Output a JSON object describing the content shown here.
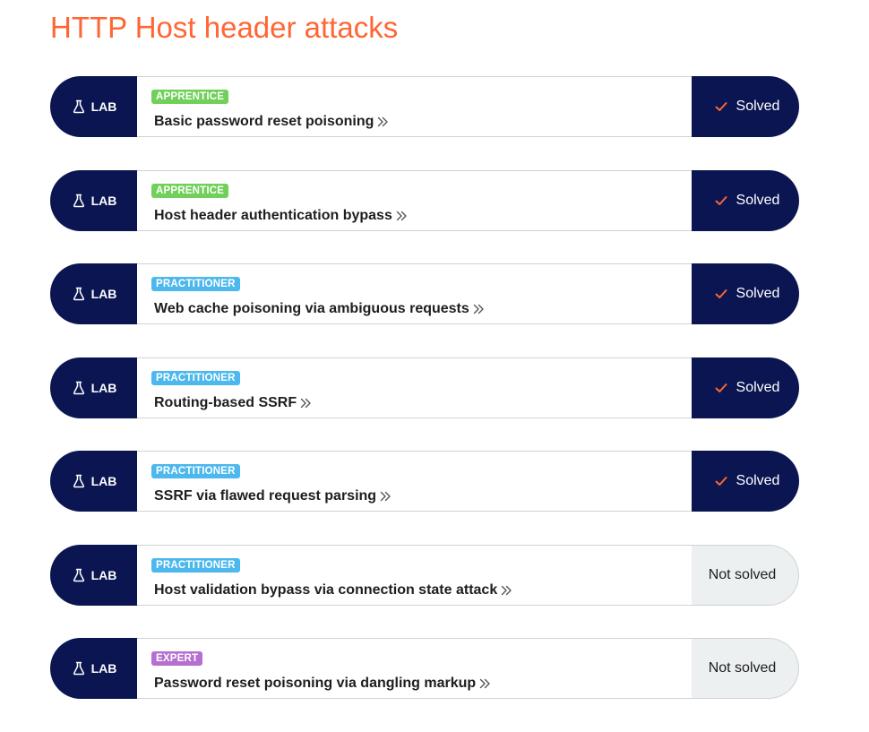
{
  "page": {
    "title": "HTTP Host header attacks"
  },
  "labs": [
    {
      "tag": "LAB",
      "level": "APPRENTICE",
      "level_class": "apprentice",
      "title": "Basic password reset poisoning",
      "status": "Solved",
      "solved": true
    },
    {
      "tag": "LAB",
      "level": "APPRENTICE",
      "level_class": "apprentice",
      "title": "Host header authentication bypass",
      "status": "Solved",
      "solved": true
    },
    {
      "tag": "LAB",
      "level": "PRACTITIONER",
      "level_class": "practitioner",
      "title": "Web cache poisoning via ambiguous requests",
      "status": "Solved",
      "solved": true
    },
    {
      "tag": "LAB",
      "level": "PRACTITIONER",
      "level_class": "practitioner",
      "title": "Routing-based SSRF",
      "status": "Solved",
      "solved": true
    },
    {
      "tag": "LAB",
      "level": "PRACTITIONER",
      "level_class": "practitioner",
      "title": "SSRF via flawed request parsing",
      "status": "Solved",
      "solved": true
    },
    {
      "tag": "LAB",
      "level": "PRACTITIONER",
      "level_class": "practitioner",
      "title": "Host validation bypass via connection state attack",
      "status": "Not solved",
      "solved": false
    },
    {
      "tag": "LAB",
      "level": "EXPERT",
      "level_class": "expert",
      "title": "Password reset poisoning via dangling markup",
      "status": "Not solved",
      "solved": false
    }
  ],
  "icons": {
    "lab_tag": "flask-icon",
    "link_suffix": "double-chevron-right-icon",
    "solved_marker": "check-icon"
  },
  "colors": {
    "title": "#ff6633",
    "navy": "#0a1551",
    "apprentice": "#70d05a",
    "practitioner": "#4cb8ee",
    "expert": "#b56fcf",
    "check": "#ff6633",
    "unsolved_bg": "#ecf0f1"
  }
}
